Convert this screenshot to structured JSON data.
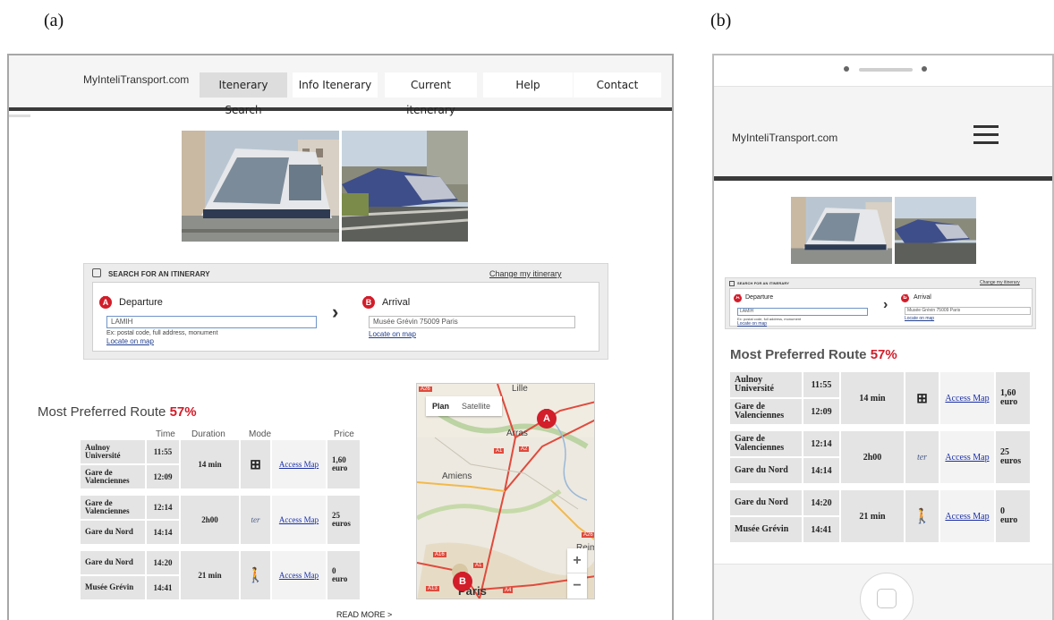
{
  "labels": {
    "a": "(a)",
    "b": "(b)"
  },
  "desktop": {
    "brand": "MyInteliTransport.com",
    "nav": [
      "Itenerary Search",
      "Info Itenerary",
      "Current itenerary",
      "Help",
      "Contact"
    ],
    "active_nav": "Itenerary Search"
  },
  "search": {
    "title": "SEARCH FOR AN ITINERARY",
    "change": "Change my itinerary",
    "departure_label": "Departure",
    "departure_pin": "A",
    "departure_value": "LAMIH",
    "hint": "Ex: postal code, full address, monument",
    "locate": "Locate on map",
    "arrival_label": "Arrival",
    "arrival_pin": "B",
    "arrival_value": "Musée Grévin 75009 Paris",
    "chevron": "›"
  },
  "route": {
    "title": "Most Preferred Route",
    "percent": "57%",
    "headers": [
      "Time",
      "Duration",
      "Mode",
      "Price"
    ],
    "legs": [
      {
        "from": "Aulnoy Université",
        "from_time": "11:55",
        "to": "Gare de Valenciennes",
        "to_time": "12:09",
        "duration": "14 min",
        "mode_icon": "metro-icon",
        "link": "Access Map",
        "price_value": "1,60",
        "price_unit": "euro"
      },
      {
        "from": "Gare de Valenciennes",
        "from_time": "12:14",
        "to": "Gare du Nord",
        "to_time": "14:14",
        "duration": "2h00",
        "mode_icon": "ter-train-icon",
        "link": "Access Map",
        "price_value": "25",
        "price_unit": "euros"
      },
      {
        "from": "Gare du Nord",
        "from_time": "14:20",
        "to": "Musée Grévin",
        "to_time": "14:41",
        "duration": "21 min",
        "mode_icon": "walk-icon",
        "link": "Access Map",
        "price_value": "0",
        "price_unit": "euro"
      }
    ],
    "mode_glyphs": {
      "metro": "⊞",
      "ter": "ter",
      "walk": "🚶"
    },
    "read_more": "READ MORE >"
  },
  "map": {
    "tabs": [
      "Plan",
      "Satellite"
    ],
    "zoom_in": "+",
    "zoom_out": "−",
    "marker_a": "A",
    "marker_b": "B",
    "places": [
      "Lille",
      "Arras",
      "Amiens",
      "Reim",
      "Paris"
    ],
    "roads": [
      "A26",
      "A1",
      "A2",
      "A16",
      "A1",
      "A13",
      "A4",
      "A26"
    ],
    "colors": {
      "marker": "#d21d2a",
      "road_red": "#e04a3c",
      "road_orange": "#f2b94b"
    }
  },
  "phone": {
    "brand": "MyInteliTransport.com"
  }
}
